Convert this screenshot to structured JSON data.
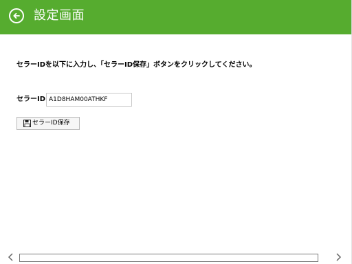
{
  "header": {
    "title": "設定画面",
    "background_color": "#56ac2f",
    "back_icon": "arrow-left-circle-icon"
  },
  "main": {
    "instruction": "セラーIDを以下に入力し、「セラーID保存」ボタンをクリックしてください。",
    "seller_id": {
      "label": "セラーID",
      "value": "A1D8HAM00ATHKF",
      "placeholder": ""
    },
    "save_button": {
      "label": "セラーID保存",
      "icon": "floppy-disk-icon"
    }
  },
  "scrollbar": {
    "left_icon": "chevron-left-icon",
    "right_icon": "chevron-right-icon"
  }
}
